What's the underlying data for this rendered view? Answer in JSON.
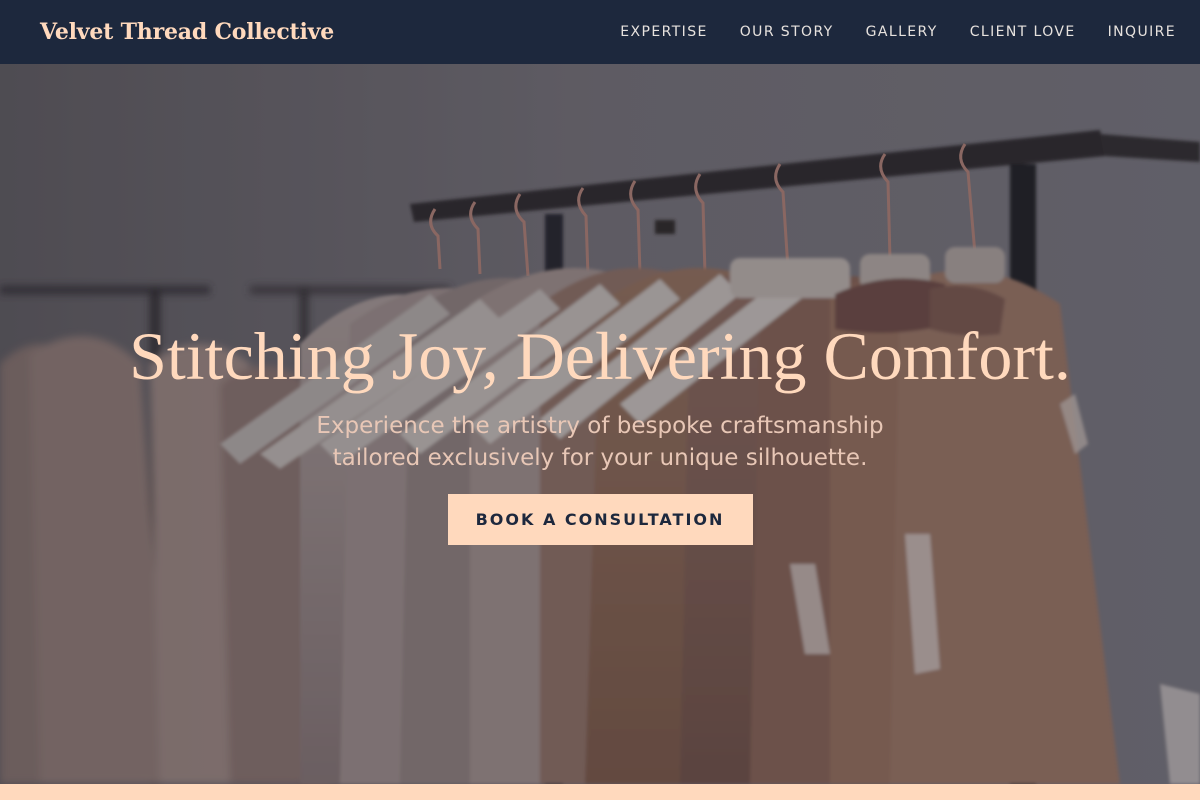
{
  "brand": {
    "name": "Velvet Thread Collective"
  },
  "nav": {
    "items": [
      {
        "label": "EXPERTISE"
      },
      {
        "label": "OUR STORY"
      },
      {
        "label": "GALLERY"
      },
      {
        "label": "CLIENT LOVE"
      },
      {
        "label": "INQUIRE"
      }
    ]
  },
  "hero": {
    "title": "Stitching Joy, Delivering Comfort.",
    "subtitle": "Experience the artistry of bespoke craftsmanship tailored exclusively for your unique silhouette.",
    "cta_label": "BOOK A CONSULTATION",
    "image_subject": "clothing-rack-with-garments-on-hangers"
  },
  "colors": {
    "nav_background": "#1d283d",
    "accent_peach": "#ffd9bd",
    "cta_text": "#1d283d",
    "subtitle_text": "#e8c7b6",
    "nav_text": "#e7e2de"
  }
}
